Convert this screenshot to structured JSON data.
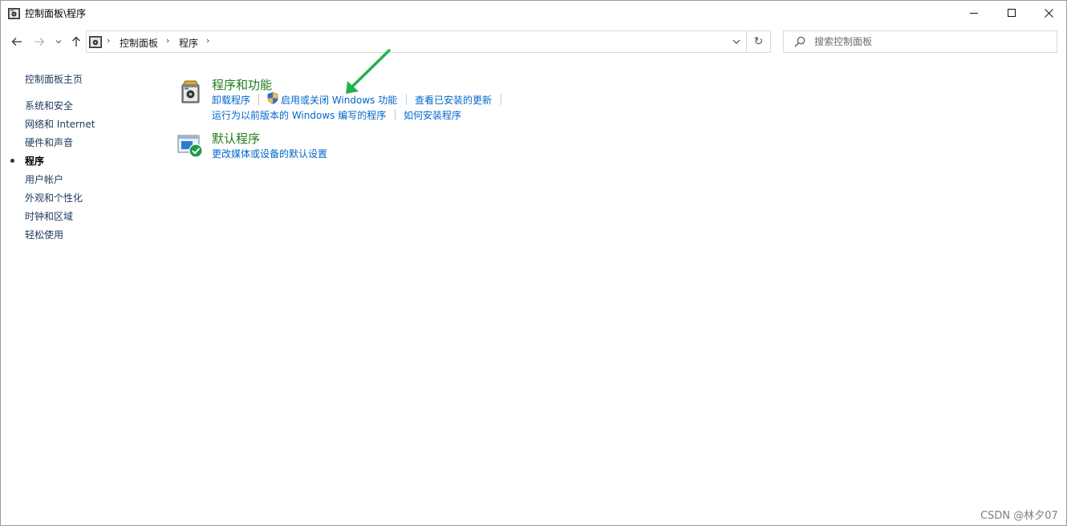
{
  "window": {
    "title": "控制面板\\程序"
  },
  "addressbar": {
    "crumbs": [
      "控制面板",
      "程序"
    ]
  },
  "search": {
    "placeholder": "搜索控制面板"
  },
  "sidebar": {
    "home": "控制面板主页",
    "items": [
      {
        "label": "系统和安全"
      },
      {
        "label": "网络和 Internet"
      },
      {
        "label": "硬件和声音"
      },
      {
        "label": "程序",
        "active": true
      },
      {
        "label": "用户帐户"
      },
      {
        "label": "外观和个性化"
      },
      {
        "label": "时钟和区域"
      },
      {
        "label": "轻松使用"
      }
    ]
  },
  "categories": [
    {
      "title": "程序和功能",
      "icon": "programs-features-icon",
      "links_row1": [
        "卸载程序",
        "启用或关闭 Windows 功能",
        "查看已安装的更新"
      ],
      "links_row2": [
        "运行为以前版本的 Windows 编写的程序",
        "如何安装程序"
      ]
    },
    {
      "title": "默认程序",
      "icon": "default-programs-icon",
      "links_row1": [
        "更改媒体或设备的默认设置"
      ]
    }
  ],
  "annotation": {
    "arrow_color": "#22b14c"
  },
  "watermark": "CSDN @林夕07",
  "colors": {
    "link": "#0066cc",
    "category_title": "#1e7d1e",
    "sidebar_link": "#1e395b"
  }
}
